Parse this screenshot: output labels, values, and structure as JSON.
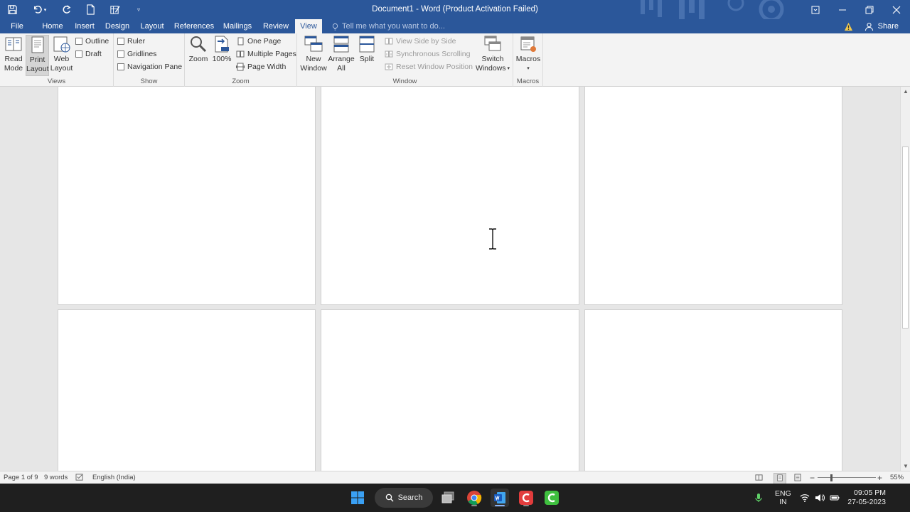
{
  "titlebar": {
    "title": "Document1 - Word (Product Activation Failed)"
  },
  "tabs": [
    {
      "label": "File",
      "active": false
    },
    {
      "label": "Home",
      "active": false
    },
    {
      "label": "Insert",
      "active": false
    },
    {
      "label": "Design",
      "active": false
    },
    {
      "label": "Layout",
      "active": false
    },
    {
      "label": "References",
      "active": false
    },
    {
      "label": "Mailings",
      "active": false
    },
    {
      "label": "Review",
      "active": false
    },
    {
      "label": "View",
      "active": true
    }
  ],
  "tellme": {
    "placeholder": "Tell me what you want to do..."
  },
  "share": {
    "label": "Share"
  },
  "ribbon": {
    "views": {
      "label": "Views",
      "read_mode": [
        "Read",
        "Mode"
      ],
      "print_layout": [
        "Print",
        "Layout"
      ],
      "web_layout": [
        "Web",
        "Layout"
      ],
      "outline": "Outline",
      "draft": "Draft"
    },
    "show": {
      "label": "Show",
      "ruler": "Ruler",
      "gridlines": "Gridlines",
      "navigation_pane": "Navigation Pane"
    },
    "zoom": {
      "label": "Zoom",
      "zoom": "Zoom",
      "hundred": "100%",
      "one_page": "One Page",
      "multiple_pages": "Multiple Pages",
      "page_width": "Page Width"
    },
    "window": {
      "label": "Window",
      "new_window": [
        "New",
        "Window"
      ],
      "arrange_all": [
        "Arrange",
        "All"
      ],
      "split": "Split",
      "view_side_by_side": "View Side by Side",
      "sync_scrolling": "Synchronous Scrolling",
      "reset_window_position": "Reset Window Position",
      "switch_windows": [
        "Switch",
        "Windows"
      ]
    },
    "macros": {
      "label": "Macros",
      "macros": "Macros"
    }
  },
  "status": {
    "page": "Page 1 of 9",
    "words": "9 words",
    "language": "English (India)",
    "zoom_level": "55%",
    "zoom_minus": "−",
    "zoom_plus": "+"
  },
  "taskbar": {
    "search": "Search",
    "lang": [
      "ENG",
      "IN"
    ],
    "time": "09:05 PM",
    "date": "27-05-2023"
  },
  "colors": {
    "accent": "#2b579a",
    "ribbon_bg": "#f3f3f3",
    "canvas_bg": "#e6e6e6",
    "taskbar_bg": "#1f1f1f"
  }
}
